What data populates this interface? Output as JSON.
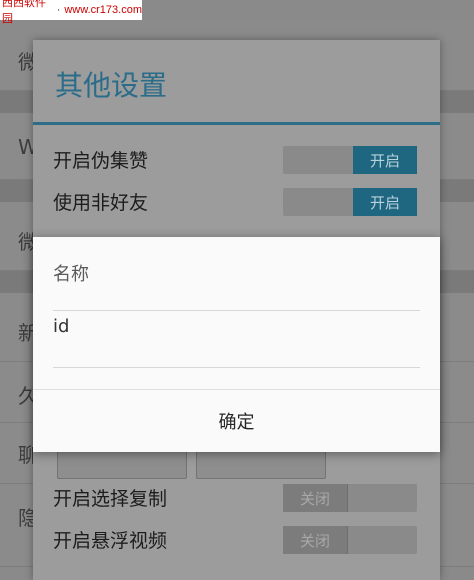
{
  "watermark": {
    "site_name": "西西软件园",
    "url": "www.cr173.com"
  },
  "background_list": {
    "items": [
      "微",
      "W",
      "微",
      "新",
      "久",
      "聊",
      "隐"
    ]
  },
  "other_settings_dialog": {
    "title": "其他设置",
    "options": [
      {
        "label": "开启伪集赞",
        "state": "开启",
        "on": true
      },
      {
        "label": "使用非好友",
        "state": "开启",
        "on": true
      },
      {
        "label": "开启选择复制",
        "state": "关闭",
        "on": false
      },
      {
        "label": "开启悬浮视频",
        "state": "关闭",
        "on": false
      }
    ]
  },
  "input_dialog": {
    "name_placeholder": "名称",
    "id_value": "id",
    "confirm_label": "确定"
  },
  "colors": {
    "accent": "#1f6680",
    "title_blue": "#2a6c89",
    "overlay_dim": "#8a8a8a"
  }
}
